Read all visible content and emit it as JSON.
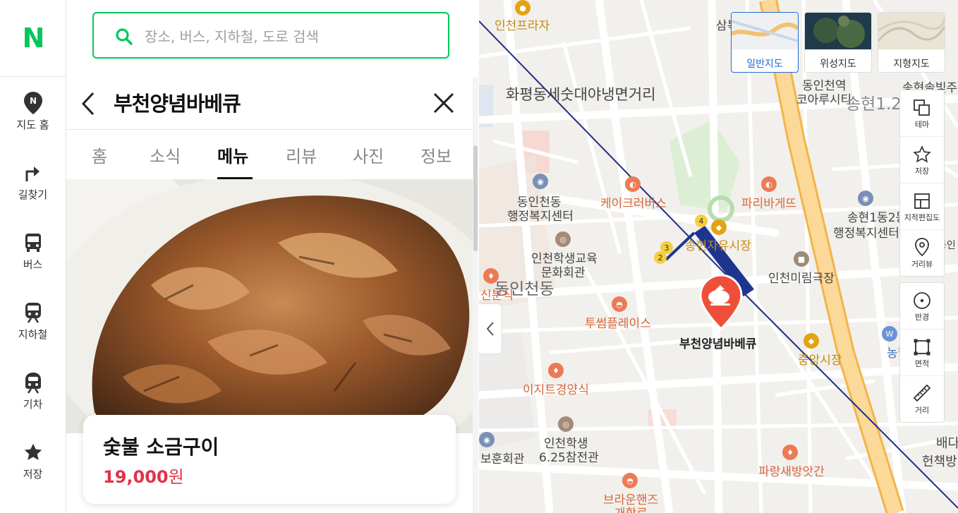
{
  "rail": {
    "logo": "N",
    "items": [
      {
        "label": "지도 홈",
        "icon": "map-pin-icon"
      },
      {
        "label": "길찾기",
        "icon": "directions-icon"
      },
      {
        "label": "버스",
        "icon": "bus-icon"
      },
      {
        "label": "지하철",
        "icon": "subway-icon"
      },
      {
        "label": "기차",
        "icon": "train-icon"
      },
      {
        "label": "저장",
        "icon": "star-icon"
      }
    ]
  },
  "search": {
    "placeholder": "장소, 버스, 지하철, 도로 검색"
  },
  "place": {
    "name": "부천양념바베큐",
    "tabs": [
      "홈",
      "소식",
      "메뉴",
      "리뷰",
      "사진",
      "정보"
    ],
    "active_tab": "메뉴",
    "menu_item": {
      "name": "숯불 소금구이",
      "price": "19,000",
      "unit": "원"
    }
  },
  "map": {
    "types": [
      {
        "label": "일반지도",
        "selected": true
      },
      {
        "label": "위성지도",
        "selected": false
      },
      {
        "label": "지형지도",
        "selected": false
      }
    ],
    "tools_top": [
      {
        "label": "테마",
        "icon": "layers-icon"
      },
      {
        "label": "저장",
        "icon": "star-outline-icon"
      },
      {
        "label": "지적편집도",
        "icon": "cadastral-icon"
      },
      {
        "label": "거리뷰",
        "icon": "street-view-icon"
      }
    ],
    "tools_bottom": [
      {
        "label": "반경",
        "icon": "radius-icon"
      },
      {
        "label": "면적",
        "icon": "area-icon"
      },
      {
        "label": "거리",
        "icon": "ruler-icon"
      }
    ],
    "marker_label": "부천양념바베큐",
    "labels": {
      "incheon_plaza": "인천프라자",
      "samgok": "삼복",
      "hwapyeong": "화평동세숫대야냉면거리",
      "dongincheon_station": "동인천역",
      "coarusi": "코아루시티",
      "songhyeon_1": "송현1.2",
      "songhyeon_sol": "송현솔빛주공",
      "dongincheon_center_1": "동인천동",
      "dongincheon_center_2": "행정복지센터",
      "kcrbus": "케이크러버스",
      "paris": "파리바게뜨",
      "songhyeon_center_1": "송현1동2동",
      "songhyeon_center_2": "행정복지센터",
      "songhyeon_market": "송현자유시장",
      "edu_center_1": "인천학생교육",
      "edu_center_2": "문화회관",
      "dongincheondong": "동인천동",
      "sinbunsik": "신분식",
      "mirim": "인천미림극장",
      "tossom": "투썸플레이스",
      "jungang_market": "중앙시장",
      "nonghyeop": "농협",
      "easyt": "이지트경양식",
      "student625_1": "인천학생",
      "student625_2": "6.25참전관",
      "hoonhoe": "보훈회관",
      "parang": "파랑새방앗간",
      "brown_1": "브라운핸즈",
      "brown_2": "개항로",
      "baedari_1": "배다",
      "baedari_2": "헌책방",
      "dong": "동인"
    },
    "exit_numbers": [
      "4",
      "3",
      "2"
    ]
  }
}
